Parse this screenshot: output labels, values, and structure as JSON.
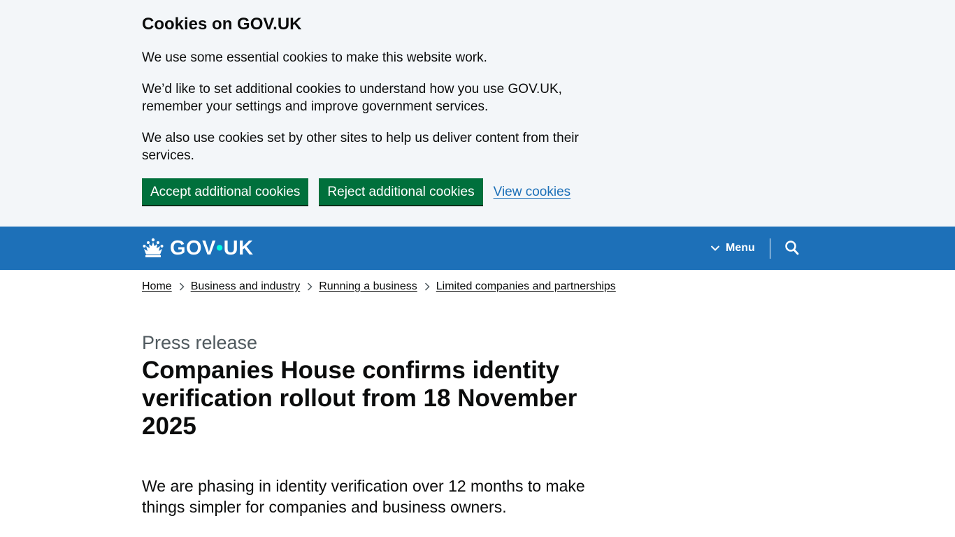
{
  "cookie_banner": {
    "title": "Cookies on GOV.UK",
    "p1": "We use some essential cookies to make this website work.",
    "p2": "We’d like to set additional cookies to understand how you use GOV.UK, remember your settings and improve government services.",
    "p3": "We also use cookies set by other sites to help us deliver content from their services.",
    "accept_label": "Accept additional cookies",
    "reject_label": "Reject additional cookies",
    "view_label": "View cookies"
  },
  "header": {
    "logo_left": "GOV",
    "logo_dot": "•",
    "logo_right": "UK",
    "menu_label": "Menu",
    "crown_icon": "crown-icon",
    "search_icon": "search-icon"
  },
  "breadcrumbs": [
    {
      "label": "Home"
    },
    {
      "label": "Business and industry"
    },
    {
      "label": "Running a business"
    },
    {
      "label": "Limited companies and partnerships"
    }
  ],
  "main": {
    "caption": "Press release",
    "title": "Companies House confirms identity verification rollout from 18 November 2025",
    "lede": "We are phasing in identity verification over 12 months to make things simpler for companies and business owners."
  },
  "colors": {
    "header_blue": "#1d70b8",
    "button_green": "#00703c",
    "banner_bg": "#f3f6f9",
    "link_blue": "#1d70b8",
    "logo_dot": "#00ffe0"
  }
}
